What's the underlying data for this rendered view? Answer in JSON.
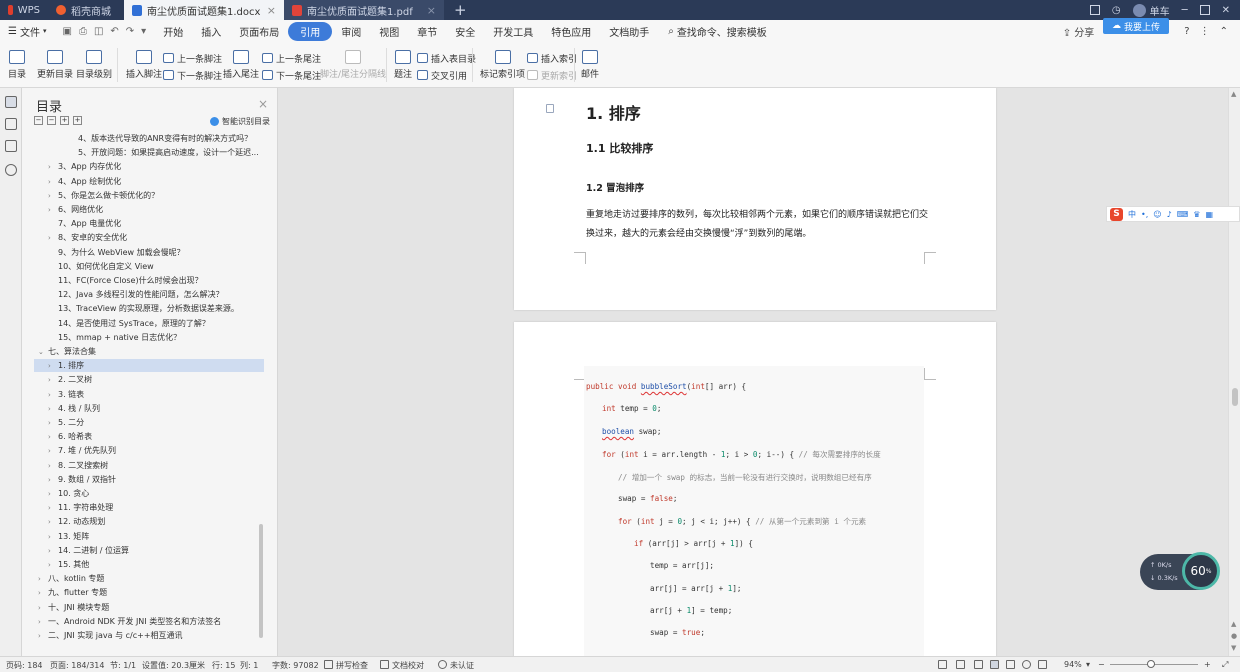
{
  "tabs": {
    "wps": "WPS",
    "shop": "稻壳商城",
    "doc": "南尘优质面试题集1.docx",
    "pdf": "南尘优质面试题集1.pdf",
    "add": "+"
  },
  "window": {
    "user": "单车"
  },
  "menu": {
    "file": "文件",
    "items": [
      "开始",
      "插入",
      "页面布局",
      "引用",
      "审阅",
      "视图",
      "章节",
      "安全",
      "开发工具",
      "特色应用",
      "文档助手"
    ],
    "search": "查找命令、搜索模板",
    "share": "分享",
    "upload": "我要上传",
    "help": "?"
  },
  "ribbon": {
    "toc": "目录",
    "update_toc": "更新目录",
    "toc_level": "目录级别",
    "insert_footnote": "插入脚注",
    "prev_footnote": "上一条脚注",
    "next_footnote": "下一条脚注",
    "insert_endnote": "插入尾注",
    "prev_endnote": "上一条尾注",
    "next_endnote": "下一条尾注",
    "foot_end_sep": "脚注/尾注分隔线",
    "caption": "题注",
    "insert_tof": "插入表目录",
    "cross_ref": "交叉引用",
    "mark_index": "标记索引项",
    "insert_index": "插入索引",
    "update_index": "更新索引",
    "mail": "邮件"
  },
  "toc": {
    "title": "目录",
    "smart": "智能识别目录",
    "items": [
      {
        "text": "4、版本迭代导致的ANR变得有时的解决方式吗？",
        "indent": 3,
        "arrow": ""
      },
      {
        "text": "5、开放问题：如果提高启动速度，设计一个延迟...",
        "indent": 3,
        "arrow": ""
      },
      {
        "text": "3、App 内存优化",
        "indent": 1,
        "arrow": "›"
      },
      {
        "text": "4、App 绘制优化",
        "indent": 1,
        "arrow": "›"
      },
      {
        "text": "5、你是怎么做卡顿优化的？",
        "indent": 1,
        "arrow": "›"
      },
      {
        "text": "6、网络优化",
        "indent": 1,
        "arrow": "›"
      },
      {
        "text": "7、App 电量优化",
        "indent": 1,
        "arrow": ""
      },
      {
        "text": "8、安卓的安全优化",
        "indent": 1,
        "arrow": "›"
      },
      {
        "text": "9、为什么 WebView 加载会慢呢？",
        "indent": 1,
        "arrow": ""
      },
      {
        "text": "10、如何优化自定义 View",
        "indent": 1,
        "arrow": ""
      },
      {
        "text": "11、FC(Force Close)什么时候会出现？",
        "indent": 1,
        "arrow": ""
      },
      {
        "text": "12、Java 多线程引发的性能问题，怎么解决？",
        "indent": 1,
        "arrow": ""
      },
      {
        "text": "13、TraceView 的实现原理，分析数据误差来源。",
        "indent": 1,
        "arrow": ""
      },
      {
        "text": "14、是否使用过 SysTrace，原理的了解？",
        "indent": 1,
        "arrow": ""
      },
      {
        "text": "15、mmap + native 日志优化？",
        "indent": 1,
        "arrow": ""
      },
      {
        "text": "七、算法合集",
        "indent": 0,
        "arrow": "⌄"
      },
      {
        "text": "1. 排序",
        "indent": 1,
        "arrow": "›",
        "selected": true
      },
      {
        "text": "2. 二叉树",
        "indent": 1,
        "arrow": "›"
      },
      {
        "text": "3. 链表",
        "indent": 1,
        "arrow": "›"
      },
      {
        "text": "4. 栈 / 队列",
        "indent": 1,
        "arrow": "›"
      },
      {
        "text": "5. 二分",
        "indent": 1,
        "arrow": "›"
      },
      {
        "text": "6. 哈希表",
        "indent": 1,
        "arrow": "›"
      },
      {
        "text": "7. 堆 / 优先队列",
        "indent": 1,
        "arrow": "›"
      },
      {
        "text": "8. 二叉搜索树",
        "indent": 1,
        "arrow": "›"
      },
      {
        "text": "9. 数组 / 双指针",
        "indent": 1,
        "arrow": "›"
      },
      {
        "text": "10. 贪心",
        "indent": 1,
        "arrow": "›"
      },
      {
        "text": "11. 字符串处理",
        "indent": 1,
        "arrow": "›"
      },
      {
        "text": "12. 动态规划",
        "indent": 1,
        "arrow": "›"
      },
      {
        "text": "13. 矩阵",
        "indent": 1,
        "arrow": "›"
      },
      {
        "text": "14. 二进制 / 位运算",
        "indent": 1,
        "arrow": "›"
      },
      {
        "text": "15. 其他",
        "indent": 1,
        "arrow": "›"
      },
      {
        "text": "八、kotlin 专题",
        "indent": 0,
        "arrow": "›"
      },
      {
        "text": "九、flutter 专题",
        "indent": 0,
        "arrow": "›"
      },
      {
        "text": "十、JNI 模块专题",
        "indent": 0,
        "arrow": "›"
      },
      {
        "text": "一、Android NDK 开发 JNI 类型签名和方法签名",
        "indent": 0,
        "arrow": "›"
      },
      {
        "text": "二、JNI 实现 java 与 c/c++相互通讯",
        "indent": 0,
        "arrow": "›"
      }
    ]
  },
  "doc": {
    "h1": "1.  排序",
    "h2": "1.1  比较排序",
    "h3": "1.2  冒泡排序",
    "para": "重复地走访过要排序的数列，每次比较相邻两个元素，如果它们的顺序错误就把它们交换过来，越大的元素会经由交换慢慢“浮”到数列的尾端。",
    "code": [
      "public void bubbleSort(int[] arr) {",
      "int temp = 0;",
      "boolean swap;",
      "for (int i = arr.length - 1; i > 0; i--) { // 每次需要排序的长度",
      "// 增加一个 swap 的标志，当前一轮没有进行交换时，说明数组已经有序",
      "swap = false;",
      "for (int j = 0; j < i; j++) { // 从第一个元素到第 i 个元素",
      "if (arr[j] > arr[j + 1]) {",
      "temp = arr[j];",
      "arr[j] = arr[j + 1];",
      "arr[j + 1] = temp;",
      "swap = true;"
    ]
  },
  "ime": {
    "logo": "S",
    "mode": "中"
  },
  "speed": {
    "percent": "60",
    "percent_unit": "%",
    "up": "0K/s",
    "down": "0.3K/s"
  },
  "status": {
    "pagenum": "页码: 184",
    "page": "页面: 184/314",
    "section": "节: 1/1",
    "setting": "设置值: 20.3厘米",
    "row": "行: 15",
    "col": "列: 1",
    "words": "字数: 97082",
    "spell": "拼写检查",
    "proof": "文档校对",
    "cert": "未认证",
    "zoom": "94%"
  }
}
